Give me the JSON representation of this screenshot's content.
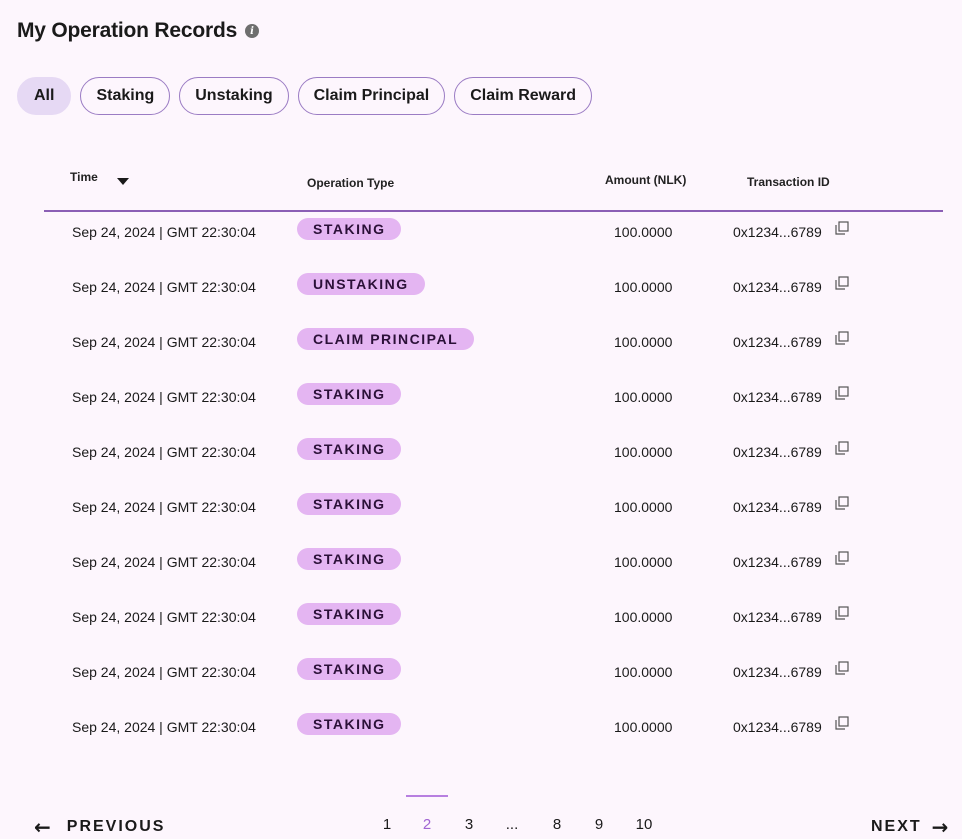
{
  "header": {
    "title": "My Operation Records",
    "info_icon": "info-icon"
  },
  "filters": [
    {
      "label": "All",
      "active": true
    },
    {
      "label": "Staking",
      "active": false
    },
    {
      "label": "Unstaking",
      "active": false
    },
    {
      "label": "Claim Principal",
      "active": false
    },
    {
      "label": "Claim Reward",
      "active": false
    }
  ],
  "table": {
    "columns": {
      "time": "Time",
      "operation_type": "Operation Type",
      "amount": "Amount (NLK)",
      "transaction_id": "Transaction ID"
    },
    "sort_icon": "triangle-down-icon",
    "rows": [
      {
        "time": "Sep 24, 2024 | GMT 22:30:04",
        "type": "STAKING",
        "amount": "100.0000",
        "tx": "0x1234...6789"
      },
      {
        "time": "Sep 24, 2024 | GMT 22:30:04",
        "type": "UNSTAKING",
        "amount": "100.0000",
        "tx": "0x1234...6789"
      },
      {
        "time": "Sep 24, 2024 | GMT 22:30:04",
        "type": "CLAIM PRINCIPAL",
        "amount": "100.0000",
        "tx": "0x1234...6789"
      },
      {
        "time": "Sep 24, 2024 | GMT 22:30:04",
        "type": "STAKING",
        "amount": "100.0000",
        "tx": "0x1234...6789"
      },
      {
        "time": "Sep 24, 2024 | GMT 22:30:04",
        "type": "STAKING",
        "amount": "100.0000",
        "tx": "0x1234...6789"
      },
      {
        "time": "Sep 24, 2024 | GMT 22:30:04",
        "type": "STAKING",
        "amount": "100.0000",
        "tx": "0x1234...6789"
      },
      {
        "time": "Sep 24, 2024 | GMT 22:30:04",
        "type": "STAKING",
        "amount": "100.0000",
        "tx": "0x1234...6789"
      },
      {
        "time": "Sep 24, 2024 | GMT 22:30:04",
        "type": "STAKING",
        "amount": "100.0000",
        "tx": "0x1234...6789"
      },
      {
        "time": "Sep 24, 2024 | GMT 22:30:04",
        "type": "STAKING",
        "amount": "100.0000",
        "tx": "0x1234...6789"
      },
      {
        "time": "Sep 24, 2024 | GMT 22:30:04",
        "type": "STAKING",
        "amount": "100.0000",
        "tx": "0x1234...6789"
      }
    ]
  },
  "pagination": {
    "previous_label": "PREVIOUS",
    "next_label": "NEXT",
    "pages": [
      "1",
      "2",
      "3",
      "...",
      "8",
      "9",
      "10"
    ],
    "current_page": "2"
  },
  "colors": {
    "background": "#fdf6fd",
    "badge": "#e4b5f2",
    "accent": "#8b5fb5",
    "current_page": "#a064d2"
  }
}
